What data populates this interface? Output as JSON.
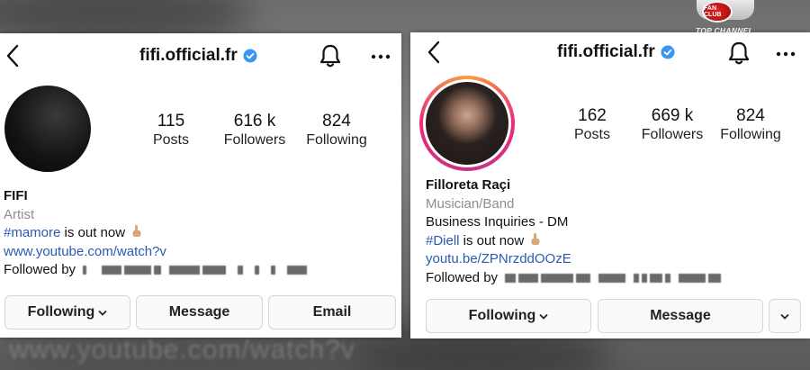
{
  "background": {
    "watermark_text": "www.youtube.com/watch?v"
  },
  "channel_logo": {
    "badge": "FAN CLUB",
    "caption": "TOP CHANNEL"
  },
  "profile_left": {
    "username": "fifi.official.fr",
    "stats": [
      {
        "value": "115",
        "label": "Posts"
      },
      {
        "value": "616 k",
        "label": "Followers"
      },
      {
        "value": "824",
        "label": "Following"
      }
    ],
    "name": "FIFI",
    "category": "Artist",
    "hashtag": "#mamore",
    "bio_rest": " is out now",
    "link": "www.youtube.com/watch?v",
    "followed_by": "Followed by",
    "buttons": {
      "following": "Following",
      "message": "Message",
      "email": "Email"
    }
  },
  "profile_right": {
    "username": "fifi.official.fr",
    "stats": [
      {
        "value": "162",
        "label": "Posts"
      },
      {
        "value": "669 k",
        "label": "Followers"
      },
      {
        "value": "824",
        "label": "Following"
      }
    ],
    "name": "Filloreta Raçi",
    "category": "Musician/Band",
    "business": "Business Inquiries - DM",
    "hashtag": "#Diell",
    "bio_rest": " is out now",
    "link": "youtu.be/ZPNrzddOOzE",
    "followed_by": "Followed by",
    "buttons": {
      "following": "Following",
      "message": "Message"
    }
  },
  "colors": {
    "link": "#2b5bb1",
    "verified": "#3897f0",
    "category": "#8e8e8e"
  },
  "icons": [
    "back-arrow-icon",
    "verified-badge-icon",
    "bell-icon",
    "more-icon",
    "pointing-hand-icon",
    "chevron-down-icon"
  ]
}
